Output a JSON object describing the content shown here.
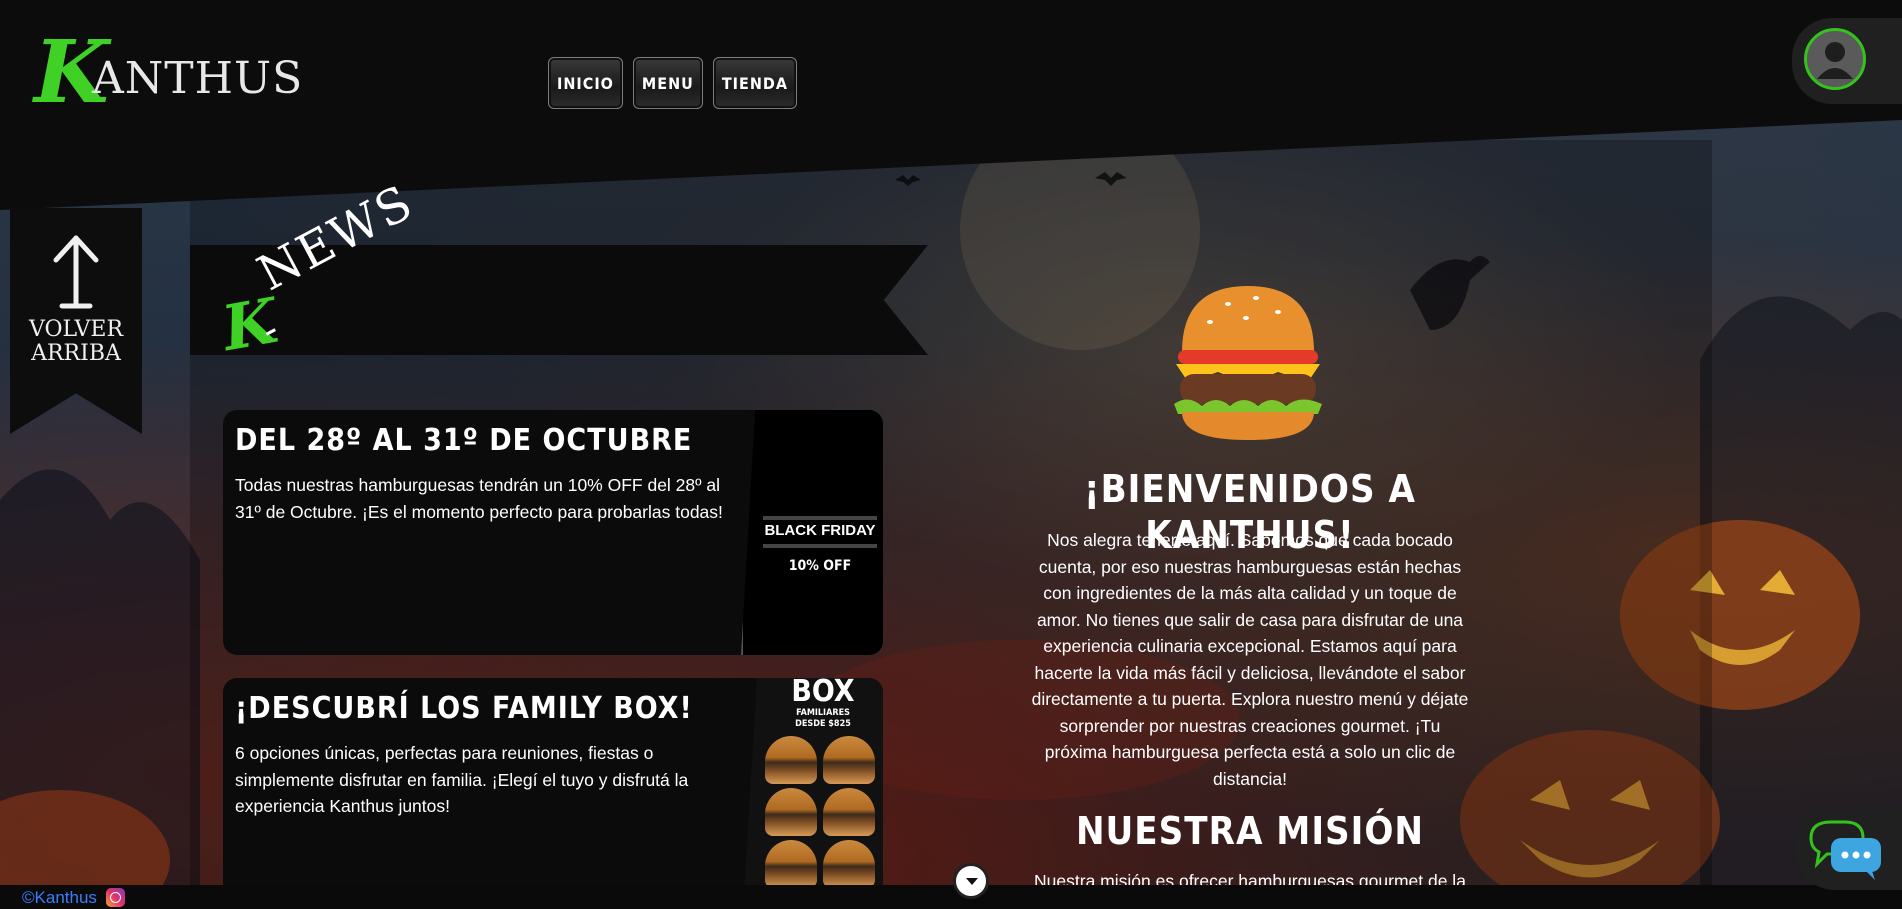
{
  "brand": {
    "logo_initial": "K",
    "logo_rest": "ANTHUS"
  },
  "nav": {
    "items": [
      {
        "label": "INICIO"
      },
      {
        "label": "MENU"
      },
      {
        "label": "TIENDA"
      }
    ]
  },
  "back_to_top": {
    "label_line1": "VOLVER",
    "label_line2": "ARRIBA"
  },
  "news_banner": {
    "k": "K",
    "dash": "-",
    "news": "NEWS"
  },
  "news": [
    {
      "title": "DEL 28º AL 31º DE OCTUBRE",
      "text": "Todas nuestras hamburguesas tendrán un 10% OFF del 28º al 31º de Octubre. ¡Es el momento perfecto para probarlas todas!",
      "image_title": "BLACK FRIDAY",
      "image_sub": "10% OFF"
    },
    {
      "title": "¡DESCUBRÍ LOS FAMILY BOX!",
      "text": "6 opciones únicas, perfectas para reuniones, fiestas o simplemente disfrutar en familia. ¡Elegí el tuyo y disfrutá la experiencia Kanthus juntos!",
      "image_title": "BOX",
      "image_sub1": "FAMILIARES",
      "image_sub2": "DESDE $825"
    }
  ],
  "welcome": {
    "title": "¡BIENVENIDOS A KANTHUS!",
    "text": "Nos alegra tenerte aquí. Sabemos que cada bocado cuenta, por eso nuestras hamburguesas están hechas con ingredientes de la más alta calidad y un toque de amor. No tienes que salir de casa para disfrutar de una experiencia culinaria excepcional. Estamos aquí para hacerte la vida más fácil y deliciosa, llevándote el sabor directamente a tu puerta. Explora nuestro menú y déjate sorprender por nuestras creaciones gourmet. ¡Tu próxima hamburguesa perfecta está a solo un clic de distancia!"
  },
  "mission": {
    "title": "NUESTRA MISIÓN",
    "text": "Nuestra misión es ofrecer hamburguesas gourmet de la"
  },
  "footer": {
    "copyright": "©Kanthus"
  },
  "colors": {
    "accent_green": "#3fd126",
    "background": "#0a0a0a",
    "link_blue": "#3a7dff"
  },
  "icons": {
    "avatar": "user-avatar-icon",
    "back_to_top": "arrow-up-icon",
    "instagram": "instagram-icon",
    "scroll_down": "chevron-down-icon",
    "chat": "chat-bubbles-icon",
    "burger": "burger-emoji-icon"
  }
}
